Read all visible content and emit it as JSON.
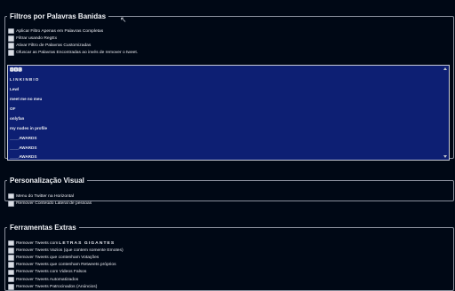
{
  "filtros": {
    "title": "Filtros por Palavras Banidas",
    "options": [
      "Aplicar Filtro Apenas em Palavras Completas",
      "Filtrar usando RegEx",
      "Ativar Filtro de Palavras Customizadas",
      "Ofuscar as Palavras Encontradas ao invés de remover o tweet."
    ],
    "textarea_lines": [
      "🅰🅱🅲",
      "LINKINBIO",
      "Lewl",
      "meet me no meu",
      "OF",
      "onlyfan",
      "my nudes in profile",
      "____AWARDS",
      "____AWARDS",
      "____AWARDS"
    ]
  },
  "visual": {
    "title": "Personalização Visual",
    "options": [
      "Menu do Twitter na Horizontal",
      "Remover Conteúdo Lateral de pessoas"
    ]
  },
  "extras": {
    "title": "Ferramentas Extras",
    "option0_prefix": "Remover Tweets com ",
    "option0_big": "LETRAS GIGANTES",
    "options": [
      "Remover Tweets Vazios (que contem somente Emotes)",
      "Remover Tweets que contenham Votações",
      "Remover Tweets que contenham Retweets próprios",
      "Remover Tweets com Videos Falsos",
      "Remover Tweets Automatizados",
      "Remover Tweets Patrocinados (Anúncios)"
    ]
  }
}
